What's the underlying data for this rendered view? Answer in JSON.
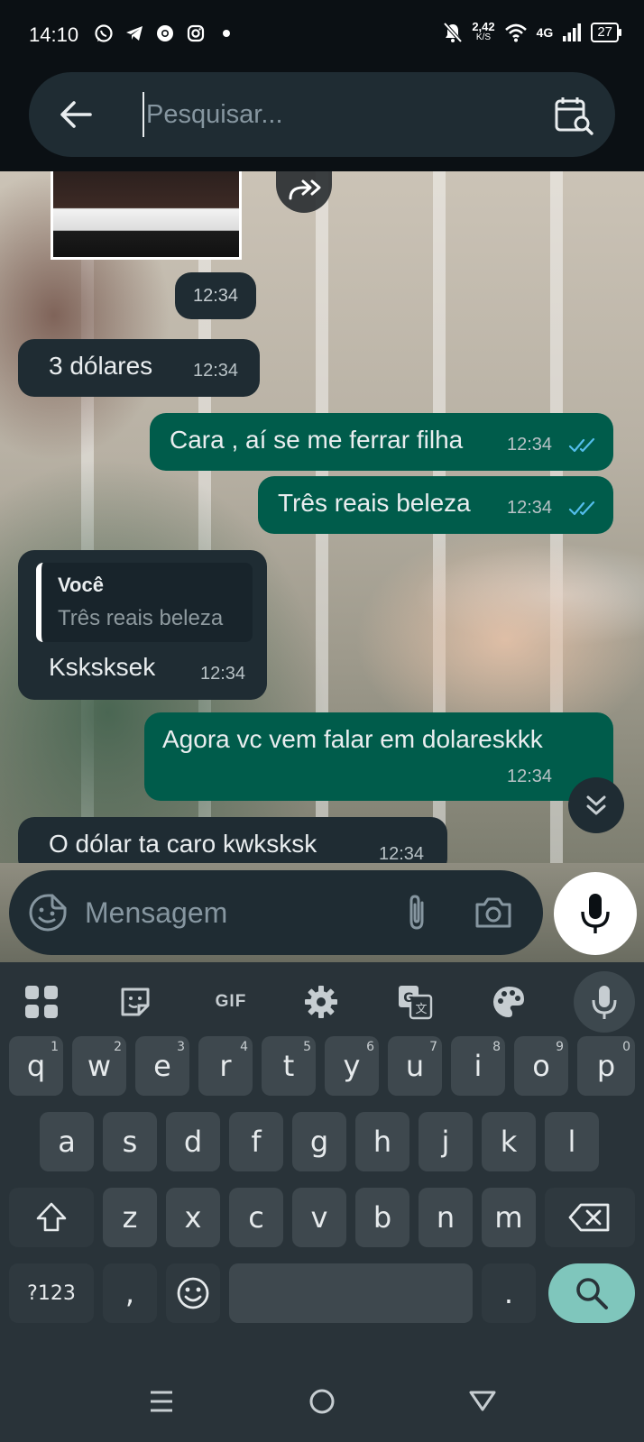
{
  "status_bar": {
    "time": "14:10",
    "app_icons": [
      "whatsapp-icon",
      "telegram-icon",
      "chrome-icon",
      "instagram-icon",
      "dot-icon"
    ],
    "net_speed_value": "2,42",
    "net_speed_unit": "K/S",
    "network_type": "4G",
    "battery": "27"
  },
  "search": {
    "placeholder": "Pesquisar..."
  },
  "chat": {
    "photo_time": "12:34",
    "messages": [
      {
        "dir": "in",
        "text": "3 dólares",
        "time": "12:34"
      },
      {
        "dir": "out",
        "text": "Cara , aí se me ferrar filha",
        "time": "12:34",
        "status": "read"
      },
      {
        "dir": "out",
        "text": "Três reais beleza",
        "time": "12:34",
        "status": "read"
      },
      {
        "dir": "in",
        "reply_author": "Você",
        "reply_text": "Três reais beleza",
        "text": "Ksksksek",
        "time": "12:34"
      },
      {
        "dir": "out",
        "text": "Agora vc vem falar em dolareskkk",
        "time": "12:34"
      },
      {
        "dir": "in",
        "text": "O dólar ta caro kwksksk",
        "time": "12:34"
      }
    ],
    "read_tick_color": "#53bdeb"
  },
  "composer": {
    "placeholder": "Mensagem"
  },
  "keyboard": {
    "toolbar": [
      "apps-grid-icon",
      "sticker-icon",
      "GIF",
      "gear-icon",
      "translate-icon",
      "palette-icon",
      "mic-icon"
    ],
    "gif_label": "GIF",
    "row1": [
      {
        "k": "q",
        "h": "1"
      },
      {
        "k": "w",
        "h": "2"
      },
      {
        "k": "e",
        "h": "3"
      },
      {
        "k": "r",
        "h": "4"
      },
      {
        "k": "t",
        "h": "5"
      },
      {
        "k": "y",
        "h": "6"
      },
      {
        "k": "u",
        "h": "7"
      },
      {
        "k": "i",
        "h": "8"
      },
      {
        "k": "o",
        "h": "9"
      },
      {
        "k": "p",
        "h": "0"
      }
    ],
    "row2": [
      "a",
      "s",
      "d",
      "f",
      "g",
      "h",
      "j",
      "k",
      "l"
    ],
    "row3": [
      "z",
      "x",
      "c",
      "v",
      "b",
      "n",
      "m"
    ],
    "symbols_label": "?123",
    "comma_label": ",",
    "period_label": "."
  },
  "colors": {
    "app_bg": "#0b1014",
    "bubble_in": "#1f2c33",
    "bubble_out": "#005c4b",
    "keyboard_bg": "#293339",
    "key_bg": "#3e484e",
    "search_key": "#7fc6bc"
  }
}
